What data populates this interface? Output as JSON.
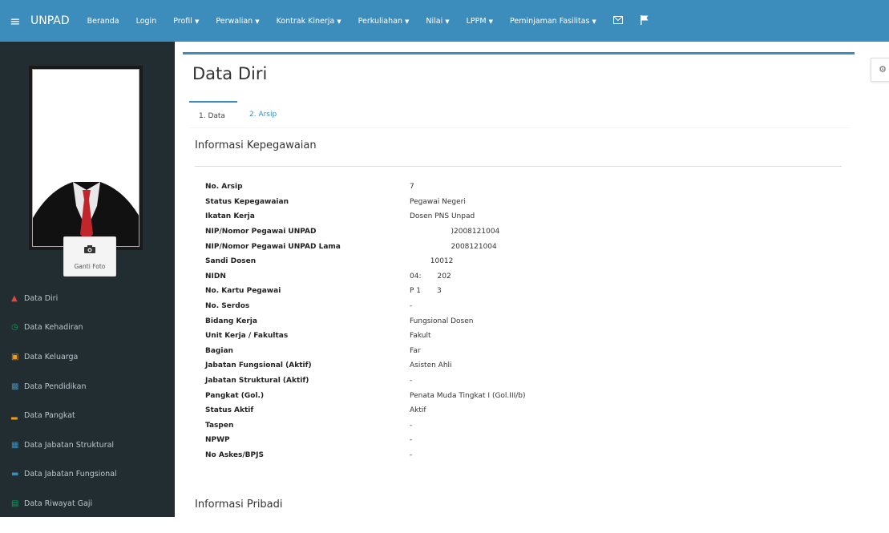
{
  "topbar": {
    "brand": "UNPAD",
    "links": [
      {
        "label": "Beranda",
        "dropdown": false
      },
      {
        "label": "Login",
        "dropdown": false
      },
      {
        "label": "Profil",
        "dropdown": true
      },
      {
        "label": "Perwalian",
        "dropdown": true
      },
      {
        "label": "Kontrak Kinerja",
        "dropdown": true
      },
      {
        "label": "Perkuliahan",
        "dropdown": true
      },
      {
        "label": "Nilai",
        "dropdown": true
      },
      {
        "label": "LPPM",
        "dropdown": true
      },
      {
        "label": "Peminjaman Fasilitas",
        "dropdown": true
      }
    ],
    "icons": [
      "hamburger-icon",
      "envelope-icon",
      "flag-icon"
    ]
  },
  "sidebar": {
    "change_photo_label": "Ganti Foto",
    "items": [
      {
        "label": "Data Diri",
        "icon": "user-icon",
        "icon_color": "#dd4b39"
      },
      {
        "label": "Data Kehadiran",
        "icon": "clock-icon",
        "icon_color": "#00a65a"
      },
      {
        "label": "Data Keluarga",
        "icon": "sitemap-icon",
        "icon_color": "#f39c12"
      },
      {
        "label": "Data Pendidikan",
        "icon": "book-icon",
        "icon_color": "#3c8dbc"
      },
      {
        "label": "Data Pangkat",
        "icon": "bar-chart-icon",
        "icon_color": "#f39c12"
      },
      {
        "label": "Data Jabatan Struktural",
        "icon": "building-icon",
        "icon_color": "#3c8dbc"
      },
      {
        "label": "Data Jabatan Fungsional",
        "icon": "briefcase-icon",
        "icon_color": "#3c8dbc"
      },
      {
        "label": "Data Riwayat Gaji",
        "icon": "money-icon",
        "icon_color": "#00a65a"
      }
    ]
  },
  "main": {
    "title": "Data Diri",
    "tabs": [
      {
        "label": "1. Data",
        "active": true
      },
      {
        "label": "2. Arsip",
        "active": false
      }
    ],
    "section_employment": "Informasi Kepegawaian",
    "section_personal": "Informasi Pribadi",
    "fields": [
      {
        "label": "No. Arsip",
        "value": "7"
      },
      {
        "label": "Status Kepegawaian",
        "value": "Pegawai Negeri"
      },
      {
        "label": "Ikatan Kerja",
        "value": "Dosen PNS Unpad"
      },
      {
        "label": "NIP/Nomor Pegawai UNPAD",
        "value": "                  )2008121004"
      },
      {
        "label": "NIP/Nomor Pegawai UNPAD Lama",
        "value": "                  2008121004"
      },
      {
        "label": "Sandi Dosen",
        "value": "         10012"
      },
      {
        "label": "NIDN",
        "value": "04:       202"
      },
      {
        "label": "No. Kartu Pegawai",
        "value": "P 1       3"
      },
      {
        "label": "No. Serdos",
        "value": "-"
      },
      {
        "label": "Bidang Kerja",
        "value": "Fungsional Dosen"
      },
      {
        "label": "Unit Kerja / Fakultas",
        "value": "Fakult"
      },
      {
        "label": "Bagian",
        "value": "Far"
      },
      {
        "label": "Jabatan Fungsional (Aktif)",
        "value": "Asisten Ahli"
      },
      {
        "label": "Jabatan Struktural (Aktif)",
        "value": "-"
      },
      {
        "label": "Pangkat (Gol.)",
        "value": "Penata Muda Tingkat I (Gol.III/b)"
      },
      {
        "label": "Status Aktif",
        "value": "Aktif"
      },
      {
        "label": "Taspen",
        "value": "-"
      },
      {
        "label": "NPWP",
        "value": "-"
      },
      {
        "label": "No Askes/BPJS",
        "value": "-"
      }
    ]
  },
  "colors": {
    "topbar": "#3c8dbc",
    "sidebar": "#222d32",
    "sidebar_text": "#b8c7ce",
    "accent": "#3c8dbc"
  }
}
